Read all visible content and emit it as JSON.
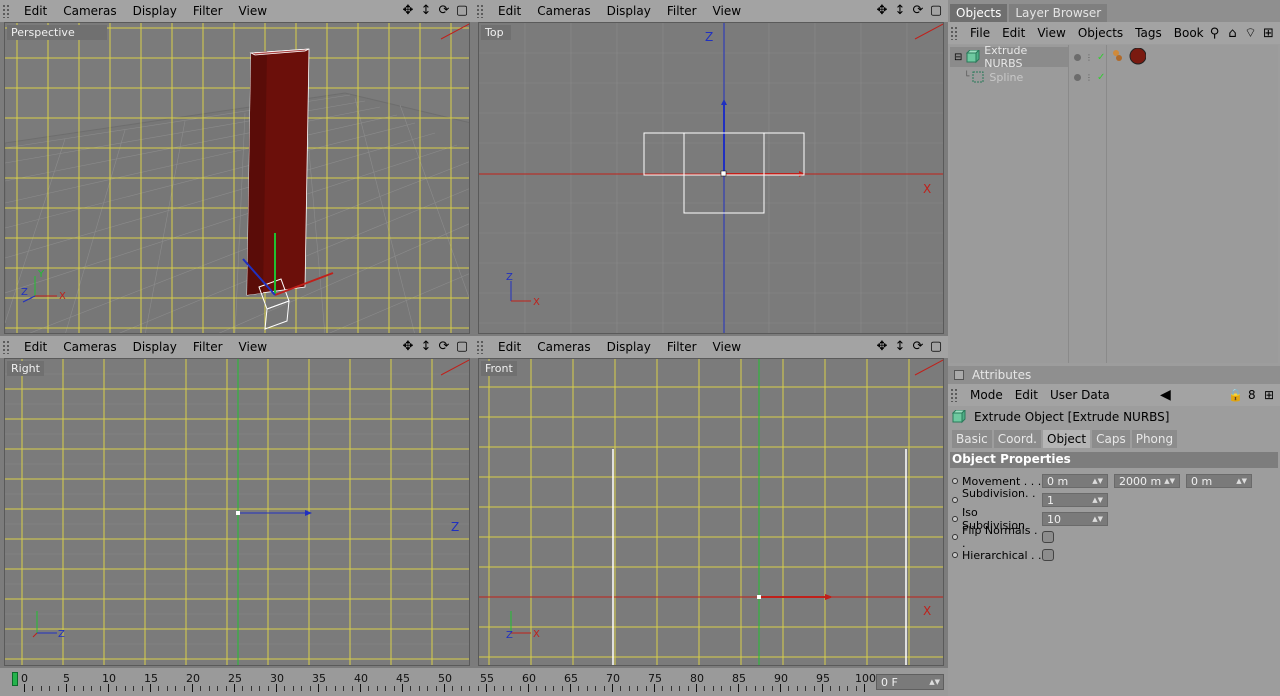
{
  "viewports": {
    "perspective": {
      "label": "Perspective",
      "menu": [
        "Edit",
        "Cameras",
        "Display",
        "Filter",
        "View"
      ]
    },
    "top": {
      "label": "Top",
      "menu": [
        "Edit",
        "Cameras",
        "Display",
        "Filter",
        "View"
      ],
      "axis_v": "Z",
      "axis_h": "X"
    },
    "right": {
      "label": "Right",
      "menu": [
        "Edit",
        "Cameras",
        "Display",
        "Filter",
        "View"
      ],
      "axis_h": "Z"
    },
    "front": {
      "label": "Front",
      "menu": [
        "Edit",
        "Cameras",
        "Display",
        "Filter",
        "View"
      ],
      "axis_h": "X"
    }
  },
  "tools": {
    "move": "✥",
    "updown": "↕",
    "rotate": "⟳",
    "maximize": "▢"
  },
  "panel": {
    "tabs": [
      "Objects",
      "Layer Browser"
    ],
    "menu": [
      "File",
      "Edit",
      "View",
      "Objects",
      "Tags",
      "Book"
    ],
    "objects": [
      {
        "name": "Extrude NURBS",
        "selected": true
      },
      {
        "name": "Spline",
        "selected": false
      }
    ]
  },
  "attributes": {
    "title": "Attributes",
    "menu": [
      "Mode",
      "Edit",
      "User Data"
    ],
    "object_header": "Extrude Object [Extrude NURBS]",
    "tabs": [
      "Basic",
      "Coord.",
      "Object",
      "Caps",
      "Phong"
    ],
    "active_tab": "Object",
    "section": "Object Properties",
    "props": {
      "movement": {
        "label": "Movement . . .",
        "values": [
          "0 m",
          "2000 m",
          "0 m"
        ]
      },
      "subdivision": {
        "label": "Subdivision. . .",
        "value": "1"
      },
      "iso": {
        "label": "Iso Subdivision",
        "value": "10"
      },
      "flip": {
        "label": "Flip Normals . ."
      },
      "hier": {
        "label": "Hierarchical . ."
      }
    }
  },
  "timeline": {
    "ticks": [
      "0",
      "5",
      "10",
      "15",
      "20",
      "25",
      "30",
      "35",
      "40",
      "45",
      "50",
      "55",
      "60",
      "65",
      "70",
      "75",
      "80",
      "85",
      "90",
      "95",
      "100"
    ],
    "frame": "0 F"
  },
  "colors": {
    "grid_major": "#d8cf4a",
    "grid_minor": "#8a8a8a",
    "object_red": "#6b0f0a",
    "axis_x": "#c0201a",
    "axis_y": "#20c030",
    "axis_z": "#2030c0"
  }
}
